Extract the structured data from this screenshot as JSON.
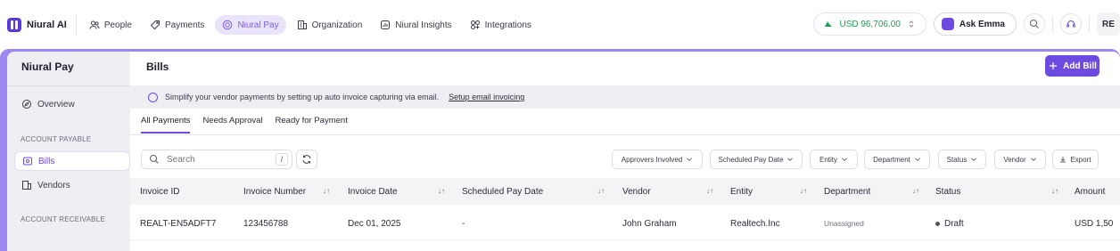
{
  "brand": "Niural AI",
  "nav": [
    {
      "label": "People",
      "icon": "people-icon"
    },
    {
      "label": "Payments",
      "icon": "tag-icon"
    },
    {
      "label": "Niural Pay",
      "icon": "niural-pay-icon"
    },
    {
      "label": "Organization",
      "icon": "building-icon"
    },
    {
      "label": "Niural Insights",
      "icon": "insights-icon"
    },
    {
      "label": "Integrations",
      "icon": "integrations-icon"
    }
  ],
  "balance": "USD 96,706.00",
  "ask": "Ask Emma",
  "avatar": "RE",
  "sidebar": {
    "title": "Niural Pay",
    "overview": "Overview",
    "section_payable": "ACCOUNT PAYABLE",
    "bills": "Bills",
    "vendors": "Vendors",
    "section_receivable": "ACCOUNT RECEIVABLE"
  },
  "page": {
    "title": "Bills",
    "add_label": "Add Bill",
    "banner_text": "Simplify your vendor payments by setting up auto invoice capturing via email.",
    "banner_link": "Setup email invoicing"
  },
  "tabs": [
    "All Payments",
    "Needs Approval",
    "Ready for Payment"
  ],
  "search": {
    "placeholder": "Search",
    "shortcut": "/"
  },
  "filters": [
    "Approvers Involved",
    "Scheduled Pay Date",
    "Entity",
    "Department",
    "Status",
    "Vendor"
  ],
  "export_label": "Export",
  "columns": [
    "Invoice ID",
    "Invoice Number",
    "Invoice Date",
    "Scheduled Pay Date",
    "Vendor",
    "Entity",
    "Department",
    "Status",
    "Amount"
  ],
  "rows": [
    {
      "invoice_id": "REALT-EN5ADFT7",
      "invoice_number": "123456788",
      "invoice_date": "Dec 01, 2025",
      "scheduled": "-",
      "vendor": "John Graham",
      "entity": "Realtech.Inc",
      "department": "Unassigned",
      "status": "Draft",
      "amount": "USD 1,50"
    }
  ]
}
